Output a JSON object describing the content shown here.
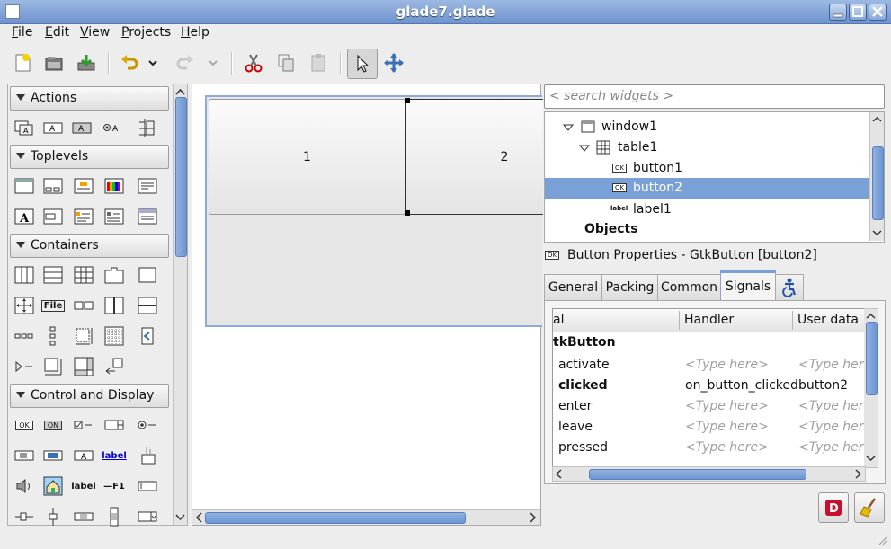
{
  "window": {
    "title": "glade7.glade"
  },
  "menu": [
    {
      "mnemonic": "F",
      "rest": "ile"
    },
    {
      "mnemonic": "E",
      "rest": "dit"
    },
    {
      "mnemonic": "V",
      "rest": "iew"
    },
    {
      "mnemonic": "P",
      "rest": "rojects"
    },
    {
      "mnemonic": "H",
      "rest": "elp"
    }
  ],
  "toolbar": {
    "icons": [
      "new-icon",
      "open-icon",
      "save-icon",
      "undo-icon",
      "redo-icon",
      "cut-icon",
      "copy-icon",
      "paste-icon",
      "select-pointer-icon",
      "drag-resize-icon"
    ]
  },
  "palette": {
    "sections": [
      "Actions",
      "Toplevels",
      "Containers",
      "Control and Display"
    ],
    "glyphs": {
      "file": "File",
      "label": "label",
      "label_plain": "label",
      "f1": "—F1",
      "ok": "OK",
      "on": "ON"
    }
  },
  "design": {
    "cell1": "1",
    "cell2": "2"
  },
  "search": {
    "placeholder": "< search widgets >"
  },
  "tree": {
    "window": "window1",
    "table": "table1",
    "button1": "button1",
    "button2": "button2",
    "label1": "label1",
    "objects": "Objects"
  },
  "properties": {
    "title": "Button Properties - GtkButton [button2]"
  },
  "tabs": [
    "General",
    "Packing",
    "Common",
    "Signals"
  ],
  "signals": {
    "headers": {
      "signal": "al",
      "handler": "Handler",
      "user_data": "User data"
    },
    "group": "tkButton",
    "rows": [
      {
        "name": "activate",
        "handler": "<Type here>",
        "data": "<Type here>",
        "bold": false
      },
      {
        "name": "clicked",
        "handler": "on_button_clicked",
        "data": "button2",
        "bold": true
      },
      {
        "name": "enter",
        "handler": "<Type here>",
        "data": "<Type here>",
        "bold": false
      },
      {
        "name": "leave",
        "handler": "<Type here>",
        "data": "<Type here>",
        "bold": false
      },
      {
        "name": "pressed",
        "handler": "<Type here>",
        "data": "<Type here>",
        "bold": false
      }
    ]
  },
  "bottom_icons": [
    "devhelp-icon",
    "clear-broom-icon"
  ]
}
